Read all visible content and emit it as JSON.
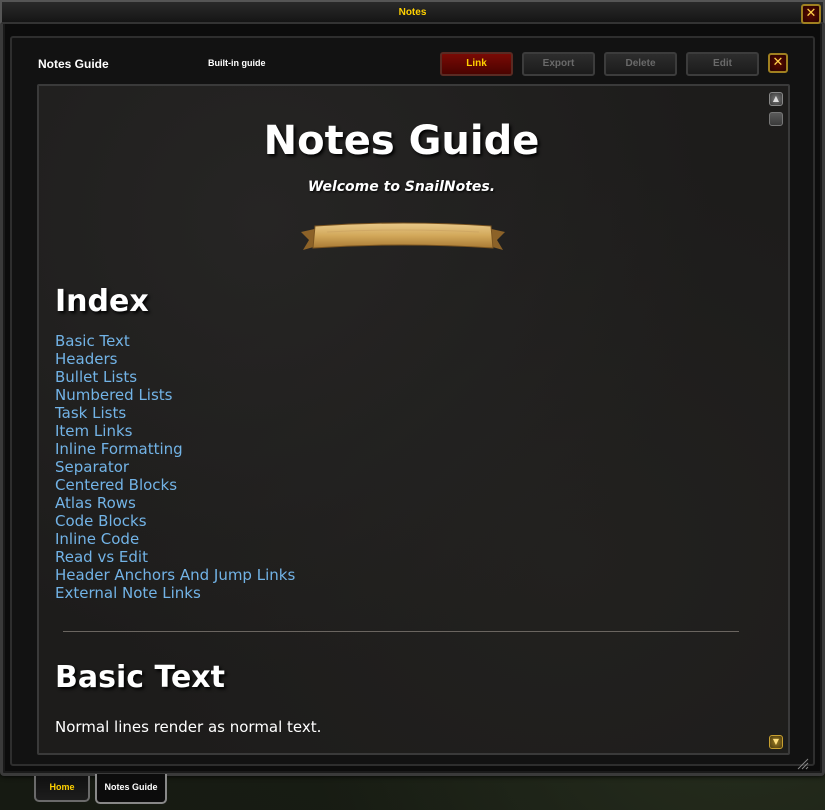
{
  "window": {
    "title": "Notes"
  },
  "header": {
    "title": "Notes Guide",
    "subtitle": "Built-in guide",
    "buttons": {
      "link": "Link",
      "export": "Export",
      "delete": "Delete",
      "edit": "Edit"
    }
  },
  "document": {
    "title": "Notes Guide",
    "subtitle": "Welcome to SnailNotes.",
    "index_heading": "Index",
    "index_items": [
      "Basic Text",
      "Headers",
      "Bullet Lists",
      "Numbered Lists",
      "Task Lists",
      "Item Links",
      "Inline Formatting",
      "Separator",
      "Centered Blocks",
      "Atlas Rows",
      "Code Blocks",
      "Inline Code",
      "Read vs Edit",
      "Header Anchors And Jump Links",
      "External Note Links"
    ],
    "section_heading": "Basic Text",
    "section_body": "Normal lines render as normal text."
  },
  "tabs": {
    "home": "Home",
    "notes_guide": "Notes Guide"
  },
  "colors": {
    "link": "#72b3e6",
    "gold": "#ffd100",
    "primary_button": "#7a0a05"
  },
  "icons": {
    "close": "close-icon",
    "scroll_up": "scroll-up-icon",
    "scroll_down": "scroll-down-icon",
    "banner": "parchment-banner-icon"
  }
}
